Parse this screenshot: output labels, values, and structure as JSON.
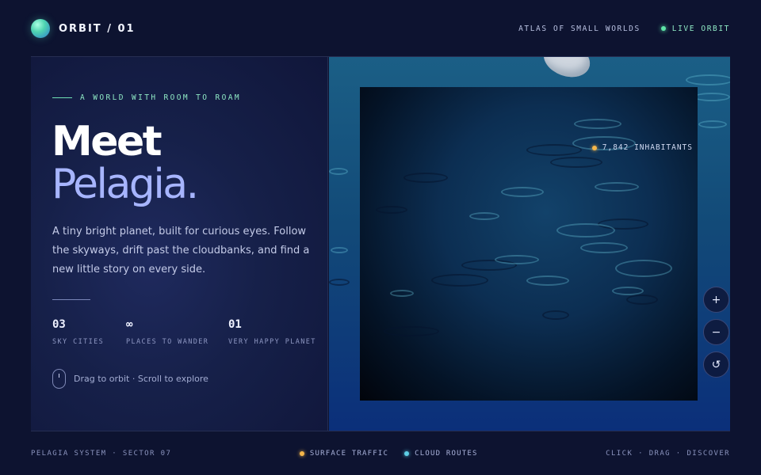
{
  "header": {
    "brand": "ORBIT / 01",
    "nav_link": "ATLAS OF SMALL WORLDS",
    "live_label": "LIVE ORBIT"
  },
  "hero": {
    "eyebrow": "A WORLD WITH ROOM TO ROAM",
    "headline_1": "Meet",
    "headline_2": "Pelagia.",
    "description": "A tiny bright planet, built for curious eyes. Follow the skyways, drift past the cloudbanks, and find a new little story on every side.",
    "stats": [
      {
        "value": "03",
        "label": "SKY CITIES"
      },
      {
        "value": "∞",
        "label": "PLACES TO WANDER"
      },
      {
        "value": "01",
        "label": "VERY HAPPY PLANET"
      }
    ],
    "hint": "Drag to orbit · Scroll to explore"
  },
  "viewport": {
    "inhabitants": "7,842 INHABITANTS",
    "controls": {
      "zoom_in": "+",
      "zoom_out": "−",
      "reset": "↺"
    }
  },
  "footer": {
    "left": "PELAGIA SYSTEM · SECTOR 07",
    "legend": [
      {
        "label": "SURFACE TRAFFIC",
        "color": "#f4b64a"
      },
      {
        "label": "CLOUD ROUTES",
        "color": "#5ecfe6"
      }
    ],
    "right": "CLICK · DRAG · DISCOVER"
  },
  "colors": {
    "accent_green": "#5ee6a8",
    "accent_lavender": "#a7b5ff",
    "background": "#0d1330"
  }
}
